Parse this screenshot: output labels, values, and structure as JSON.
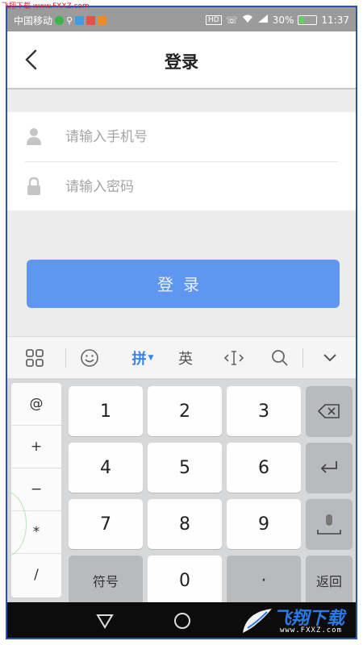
{
  "watermark_top": "飞翔下载 www.FXXZ.com",
  "status_bar": {
    "carrier": "中国移动",
    "battery": "30%",
    "time": "11:37",
    "battery_level": 0.3
  },
  "header": {
    "title": "登录",
    "back_icon": "chevron-left-icon"
  },
  "form": {
    "phone_placeholder": "请输入手机号",
    "password_placeholder": "请输入密码",
    "phone_icon": "user-icon",
    "password_icon": "lock-icon"
  },
  "login_button": "登录",
  "keyboard": {
    "toolbar": {
      "grid_icon": "grid-icon",
      "emoji_icon": "smiley-icon",
      "pinyin": "拼",
      "english": "英",
      "cursor_icon": "cursor-icon",
      "search_icon": "search-icon",
      "collapse_icon": "chevron-down-icon"
    },
    "side_keys": [
      "@",
      "+",
      "−",
      "*",
      "/"
    ],
    "digits": [
      "1",
      "2",
      "3",
      "4",
      "5",
      "6",
      "7",
      "8",
      "9"
    ],
    "symbol_key": "符号",
    "zero": "0",
    "dot": "·",
    "return_key": "返回"
  },
  "watermark_logo": {
    "name": "飞翔下载",
    "site": "www.FXXZ.com"
  },
  "colors": {
    "accent": "#5f97f0",
    "status_bar": "#9b9b9b"
  }
}
